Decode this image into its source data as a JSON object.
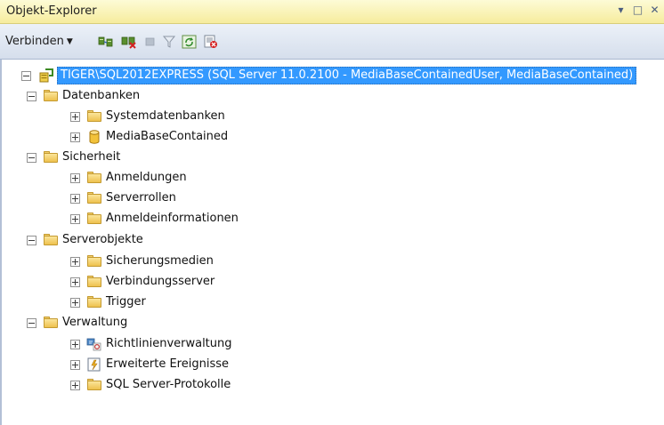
{
  "window": {
    "title": "Objekt-Explorer",
    "controls": [
      "▾",
      "□",
      "✕"
    ]
  },
  "toolbar": {
    "connect_label": "Verbinden",
    "icons": [
      "connect-object-explorer-icon",
      "disconnect-icon",
      "stop-icon",
      "filter-icon",
      "refresh-icon",
      "summary-report-icon"
    ]
  },
  "tree": {
    "server": "TIGER\\SQL2012EXPRESS (SQL Server 11.0.2100 - MediaBaseContainedUser, MediaBaseContained)",
    "databases": {
      "label": "Datenbanken",
      "children": [
        "Systemdatenbanken",
        "MediaBaseContained"
      ]
    },
    "security": {
      "label": "Sicherheit",
      "children": [
        "Anmeldungen",
        "Serverrollen",
        "Anmeldeinformationen"
      ]
    },
    "server_objects": {
      "label": "Serverobjekte",
      "children": [
        "Sicherungsmedien",
        "Verbindungsserver",
        "Trigger"
      ]
    },
    "management": {
      "label": "Verwaltung",
      "children": [
        "Richtlinienverwaltung",
        "Erweiterte Ereignisse",
        "SQL Server-Protokolle"
      ]
    }
  },
  "colors": {
    "titlebar": "#f6ec9d",
    "selection": "#3399ff",
    "folder": "#eec14e",
    "toolbar": "#d5deec"
  }
}
